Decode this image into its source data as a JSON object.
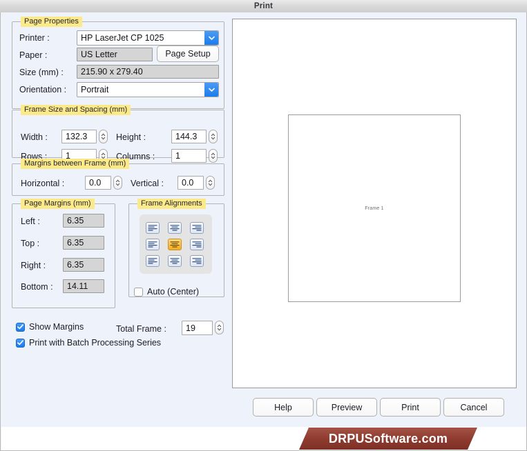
{
  "window": {
    "title": "Print"
  },
  "page_properties": {
    "group_label": "Page Properties",
    "printer_label": "Printer :",
    "printer_value": "HP LaserJet CP 1025",
    "paper_label": "Paper :",
    "paper_value": "US Letter",
    "page_setup_button": "Page Setup",
    "size_label": "Size (mm) :",
    "size_value": "215.90 x 279.40",
    "orientation_label": "Orientation :",
    "orientation_value": "Portrait"
  },
  "frame_size": {
    "group_label": "Frame Size and Spacing (mm)",
    "width_label": "Width :",
    "width_value": "132.3",
    "height_label": "Height :",
    "height_value": "144.3",
    "rows_label": "Rows :",
    "rows_value": "1",
    "columns_label": "Columns :",
    "columns_value": "1"
  },
  "margins_between_frame": {
    "group_label": "Margins between Frame (mm)",
    "horizontal_label": "Horizontal :",
    "horizontal_value": "0.0",
    "vertical_label": "Vertical :",
    "vertical_value": "0.0"
  },
  "page_margins": {
    "group_label": "Page Margins (mm)",
    "left_label": "Left :",
    "left_value": "6.35",
    "top_label": "Top :",
    "top_value": "6.35",
    "right_label": "Right :",
    "right_value": "6.35",
    "bottom_label": "Bottom :",
    "bottom_value": "14.11"
  },
  "frame_alignments": {
    "group_label": "Frame Alignments",
    "selected_index": 4,
    "cells": [
      {
        "name": "align-top-left",
        "h": "left"
      },
      {
        "name": "align-top-center",
        "h": "center"
      },
      {
        "name": "align-top-right",
        "h": "right"
      },
      {
        "name": "align-middle-left",
        "h": "left"
      },
      {
        "name": "align-middle-center",
        "h": "center"
      },
      {
        "name": "align-middle-right",
        "h": "right"
      },
      {
        "name": "align-bottom-left",
        "h": "left"
      },
      {
        "name": "align-bottom-center",
        "h": "center"
      },
      {
        "name": "align-bottom-right",
        "h": "right"
      }
    ],
    "auto_center_label": "Auto (Center)",
    "auto_center_checked": false
  },
  "options": {
    "show_margins_label": "Show Margins",
    "show_margins_checked": true,
    "batch_label": "Print with Batch Processing Series",
    "batch_checked": true,
    "total_frame_label": "Total Frame :",
    "total_frame_value": "19"
  },
  "preview": {
    "frame_label": "Frame 1"
  },
  "buttons": {
    "help": "Help",
    "preview": "Preview",
    "print": "Print",
    "cancel": "Cancel"
  },
  "branding": {
    "text": "DRPUSoftware.com"
  },
  "colors": {
    "accent_blue": "#1b7ced",
    "highlight_yellow": "#fbe98a",
    "selected_amber": "#f2ab1e",
    "banner_maroon": "#8e3a2e",
    "window_bg": "#eef2fa"
  }
}
